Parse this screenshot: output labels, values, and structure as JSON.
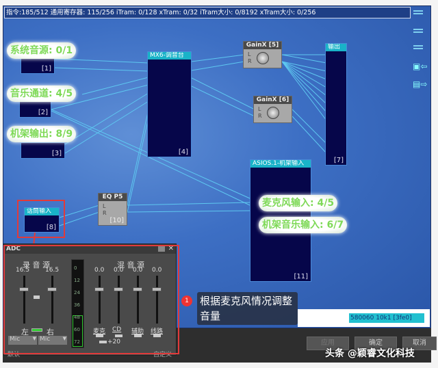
{
  "status_bar": "指令:185/512 通用寄存器: 115/256 iTram: 0/128 xTram: 0/32 iTram大小: 0/8192 xTram大小: 0/256",
  "tags": {
    "sys": "系统音源: 0/1",
    "music": "音乐通道: 4/5",
    "rack_out": "机架输出: 8/9",
    "mic_in": "麦克风输入: 4/5",
    "rack_music_in": "机架音乐输入: 6/7"
  },
  "blocks": {
    "b1": "[1]",
    "b2": "[2]",
    "b3": "[3]",
    "mx6_title": "MX6-调音台",
    "mx6_num": "[4]",
    "gain5_title": "GainX [5]",
    "gain6_title": "GainX [6]",
    "out_title": "输出",
    "out_num": "[7]",
    "mic_title": "话筒输入",
    "mic_num": "[8]",
    "eq_title": "EQ P5",
    "eq_num": "[10]",
    "asio_title": "ASIOS.1-机架输入",
    "asio_num": "[11]",
    "L": "L",
    "R": "R"
  },
  "adc": {
    "title": "ADC",
    "rec_source": "录 音 源",
    "mix_source": "混 音 源",
    "rec_left_val": "16.5",
    "rec_right_val": "16.5",
    "left": "左",
    "right": "右",
    "sel_left": "Mic",
    "sel_right": "Mic",
    "meter_ticks": [
      "0",
      "12",
      "24",
      "36",
      "48",
      "60",
      "72"
    ],
    "mix": [
      {
        "label": "麦克",
        "val": "0.0"
      },
      {
        "label": "CD",
        "val": "0.0"
      },
      {
        "label": "辅助",
        "val": "0.0"
      },
      {
        "label": "线路",
        "val": "0.0"
      }
    ],
    "boost": "+20",
    "bottom_left": "默认",
    "bottom_right": "自定义"
  },
  "callout": {
    "step": "1",
    "text": "根据麦克风情况调整音量"
  },
  "info": "580060 10k1 [3fe0]",
  "buttons": {
    "apply": "应用",
    "ok": "确定",
    "cancel": "取消"
  },
  "watermark": "头条 @颖睿文化科技",
  "colors": {
    "accent": "#19b3c8",
    "tag_text": "#7ed957",
    "highlight": "#e23a3a"
  }
}
